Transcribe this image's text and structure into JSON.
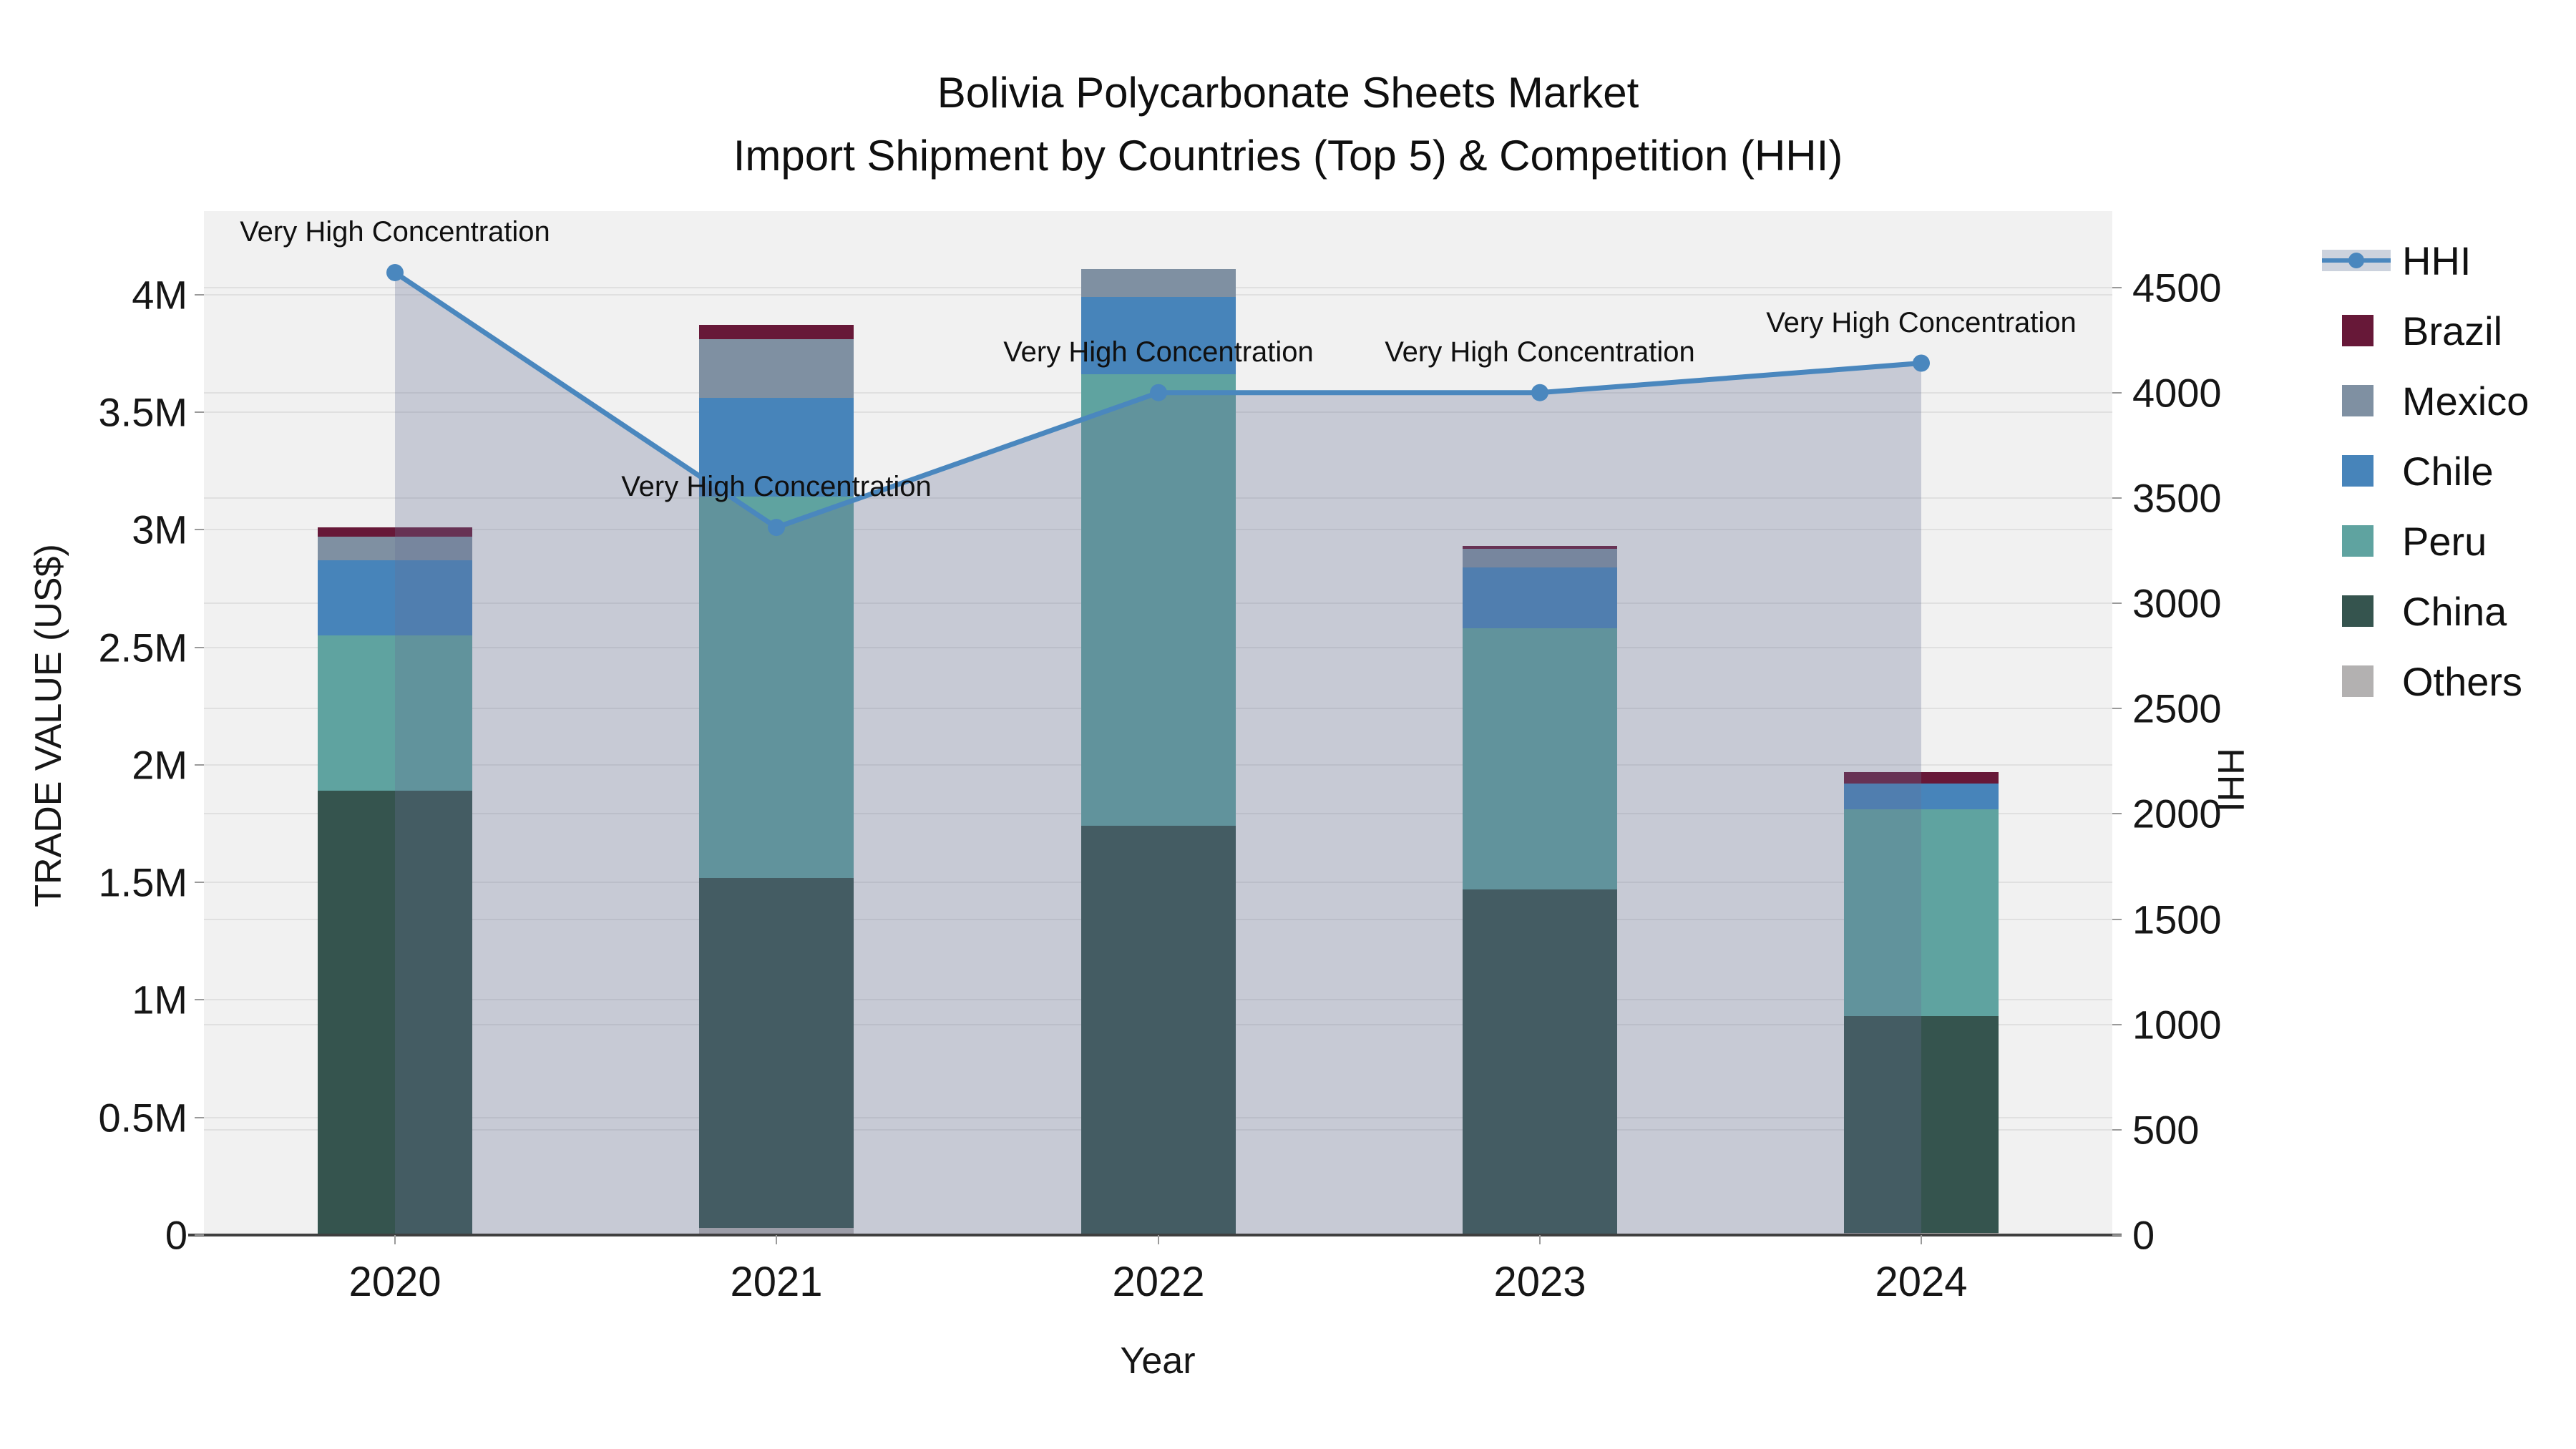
{
  "title": {
    "line1": "Bolivia Polycarbonate Sheets Market",
    "line2": "Import Shipment by Countries (Top 5) & Competition (HHI)"
  },
  "chart_data": {
    "type": "bar",
    "subtype": "stacked-bar-with-line-overlay",
    "categories": [
      "2020",
      "2021",
      "2022",
      "2023",
      "2024"
    ],
    "xlabel": "Year",
    "ylabel_left": "TRADE VALUE (US$)",
    "ylabel_right": "HHI",
    "unit_left": "millions of US$",
    "stack_order_bottom_to_top": [
      "Others",
      "China",
      "Peru",
      "Chile",
      "Mexico",
      "Brazil"
    ],
    "series": [
      {
        "name": "Brazil",
        "color": "#671838",
        "values_musd": [
          0.04,
          0.06,
          0,
          0.01,
          0.05
        ]
      },
      {
        "name": "Mexico",
        "color": "#7f90a2",
        "values_musd": [
          0.1,
          0.25,
          0.12,
          0.08,
          0
        ]
      },
      {
        "name": "Chile",
        "color": "#4784ba",
        "values_musd": [
          0.32,
          0.42,
          0.33,
          0.26,
          0.11
        ]
      },
      {
        "name": "Peru",
        "color": "#5fa3a0",
        "values_musd": [
          0.66,
          1.62,
          1.92,
          1.11,
          0.88
        ]
      },
      {
        "name": "China",
        "color": "#35544e",
        "values_musd": [
          1.89,
          1.49,
          1.74,
          1.47,
          0.92
        ]
      },
      {
        "name": "Others",
        "color": "#b3b1b1",
        "values_musd": [
          0,
          0.03,
          0,
          0,
          0.01
        ]
      }
    ],
    "bar_totals_musd": [
      3.01,
      3.87,
      4.11,
      2.93,
      1.97
    ],
    "line_series": {
      "name": "HHI",
      "color": "#4a87be",
      "area_fill": "rgba(103,113,148,0.30)",
      "values": [
        4570,
        3360,
        4000,
        4000,
        4140
      ]
    },
    "annotations": [
      "Very High Concentration",
      "Very High Concentration",
      "Very High Concentration",
      "Very High Concentration",
      "Very High Concentration"
    ],
    "y_left": {
      "tick_labels": [
        "0",
        "0.5M",
        "1M",
        "1.5M",
        "2M",
        "2.5M",
        "3M",
        "3.5M",
        "4M"
      ],
      "tick_values_musd": [
        0,
        0.5,
        1,
        1.5,
        2,
        2.5,
        3,
        3.5,
        4
      ],
      "range_musd": [
        0,
        4.355
      ]
    },
    "y_right": {
      "tick_labels": [
        "0",
        "500",
        "1000",
        "1500",
        "2000",
        "2500",
        "3000",
        "3500",
        "4000",
        "4500"
      ],
      "tick_values": [
        0,
        500,
        1000,
        1500,
        2000,
        2500,
        3000,
        3500,
        4000,
        4500
      ],
      "range": [
        0,
        4862
      ]
    },
    "grid": true,
    "legend_position": "right",
    "legend": [
      {
        "label": "HHI",
        "type": "line",
        "color": "#4a87be"
      },
      {
        "label": "Brazil",
        "type": "swatch",
        "color": "#671838"
      },
      {
        "label": "Mexico",
        "type": "swatch",
        "color": "#7f90a2"
      },
      {
        "label": "Chile",
        "type": "swatch",
        "color": "#4784ba"
      },
      {
        "label": "Peru",
        "type": "swatch",
        "color": "#5fa3a0"
      },
      {
        "label": "China",
        "type": "swatch",
        "color": "#35544e"
      },
      {
        "label": "Others",
        "type": "swatch",
        "color": "#b3b1b1"
      }
    ],
    "plot_background": "#f1f1f1"
  }
}
